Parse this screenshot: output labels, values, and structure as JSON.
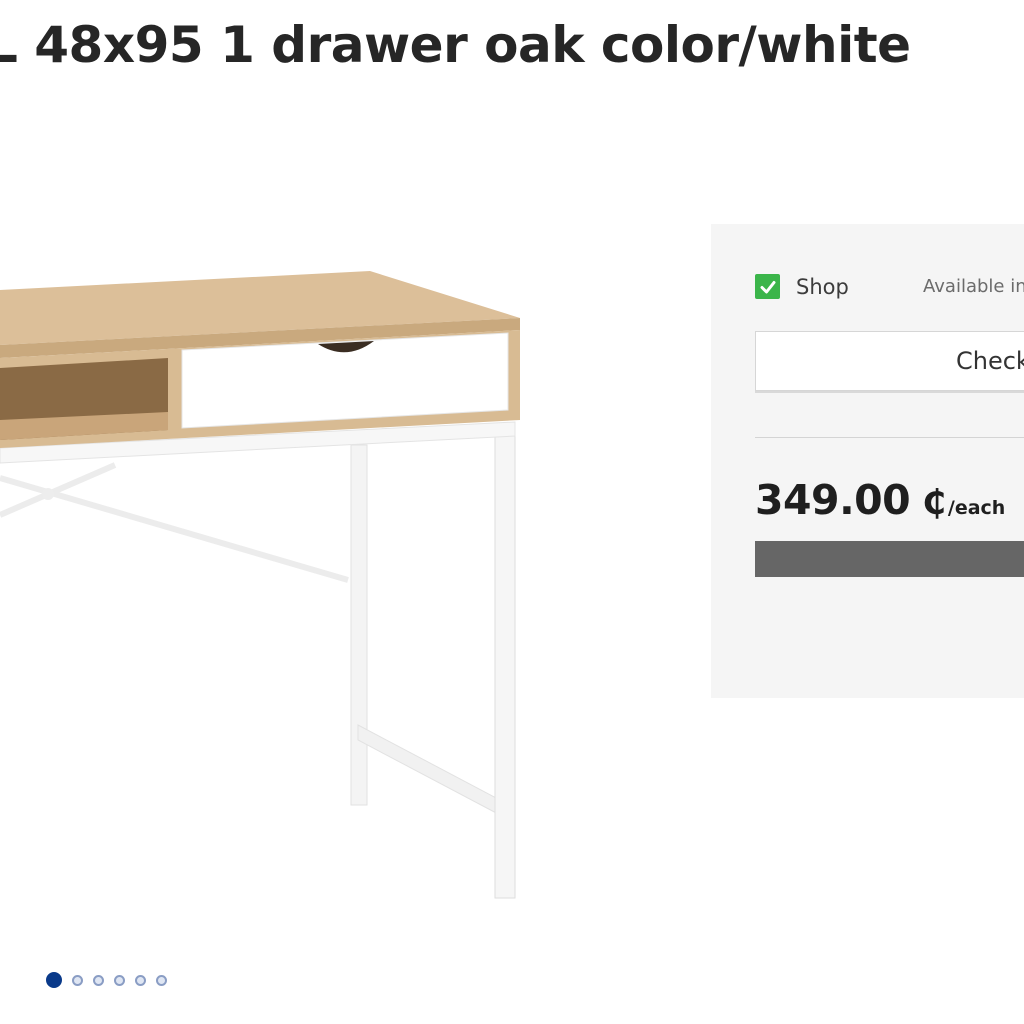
{
  "product": {
    "title": "L 48x95 1 drawer oak color/white"
  },
  "gallery": {
    "total_images": 6,
    "active_index": 0
  },
  "availability": {
    "checkbox_checked": true,
    "channel_label": "Shop",
    "status_text": "Available in",
    "check_button_label": "Check"
  },
  "pricing": {
    "price": "349.00",
    "currency_symbol": "₵",
    "unit": "/each"
  },
  "colors": {
    "check_green": "#3bb54a",
    "active_dot": "#0a3a8a",
    "panel_bg": "#f5f5f5",
    "add_button": "#666666"
  },
  "icons": {
    "availability_check": "checkmark-icon"
  }
}
